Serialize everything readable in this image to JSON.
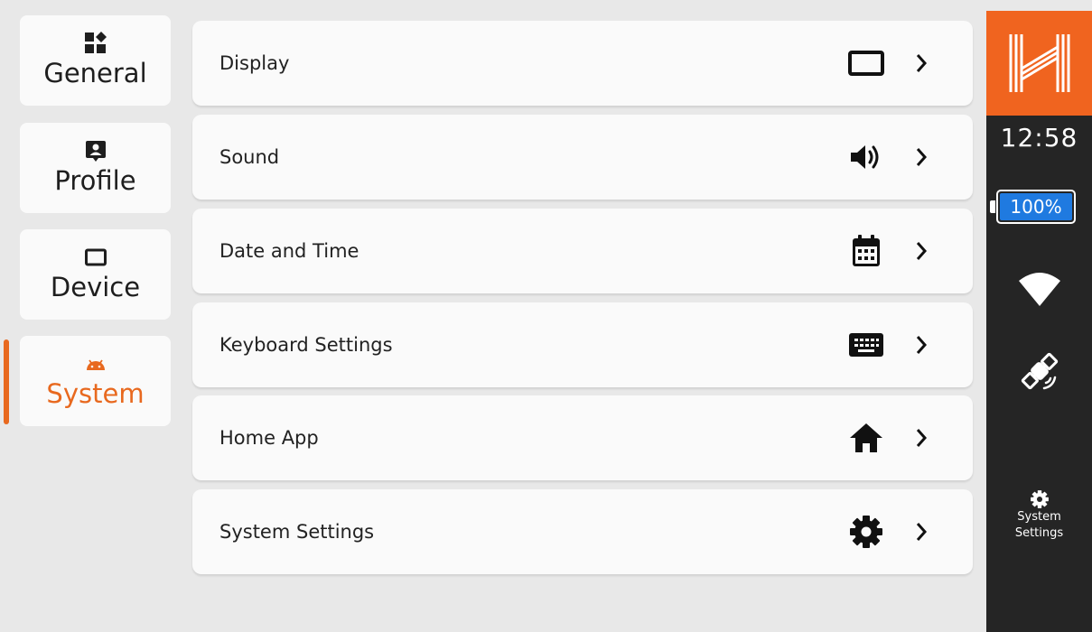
{
  "categories": [
    {
      "label": "General",
      "icon": "widgets-icon"
    },
    {
      "label": "Profile",
      "icon": "profile-icon"
    },
    {
      "label": "Device",
      "icon": "display-icon"
    },
    {
      "label": "System",
      "icon": "android-icon",
      "active": true
    }
  ],
  "settings": [
    {
      "label": "Display",
      "icon": "display-icon"
    },
    {
      "label": "Sound",
      "icon": "speaker-icon"
    },
    {
      "label": "Date and Time",
      "icon": "calendar-icon"
    },
    {
      "label": "Keyboard Settings",
      "icon": "keyboard-icon"
    },
    {
      "label": "Home App",
      "icon": "home-icon"
    },
    {
      "label": "System Settings",
      "icon": "gear-icon"
    }
  ],
  "status": {
    "time": "12:58",
    "battery": "100%",
    "system_settings_line1": "System",
    "system_settings_line2": "Settings"
  },
  "colors": {
    "accent": "#e8691f",
    "logo_bg": "#f0641f",
    "statusbar_bg": "#252525",
    "battery_fill": "#1f7ae0",
    "background": "#e8e8e8",
    "card": "#fafafa"
  }
}
